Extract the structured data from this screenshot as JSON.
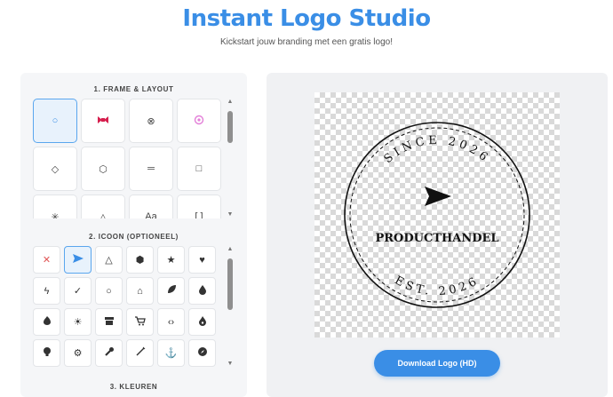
{
  "header": {
    "title": "Instant Logo Studio",
    "subtitle": "Kickstart jouw branding met een gratis logo!"
  },
  "sections": {
    "frame_title": "1. FRAME & LAYOUT",
    "icon_title": "2. ICOON (OPTIONEEL)",
    "colors_title": "3. KLEUREN"
  },
  "frames": [
    {
      "glyph": "○",
      "icon": "circle-frame-icon",
      "selected": true
    },
    {
      "glyph": "ribbon",
      "icon": "ribbon-frame-icon",
      "color": "#d61f4e"
    },
    {
      "glyph": "⊗",
      "icon": "cross-circle-frame-icon"
    },
    {
      "glyph": "flower",
      "icon": "flower-frame-icon",
      "color": "#e37fd8"
    },
    {
      "glyph": "◇",
      "icon": "diamond-frame-icon"
    },
    {
      "glyph": "⬡",
      "icon": "hexagon-frame-icon"
    },
    {
      "glyph": "═",
      "icon": "lines-frame-icon"
    },
    {
      "glyph": "□",
      "icon": "square-frame-icon"
    },
    {
      "glyph": "✳",
      "icon": "star-burst-frame-icon"
    },
    {
      "glyph": "△",
      "icon": "triangle-frame-icon"
    },
    {
      "glyph": "Aa",
      "icon": "text-frame-icon"
    },
    {
      "glyph": "[ ]",
      "icon": "brackets-frame-icon"
    }
  ],
  "icons": [
    {
      "glyph": "✕",
      "icon": "no-icon",
      "none": true
    },
    {
      "glyph": "send",
      "icon": "send-icon",
      "selected": true
    },
    {
      "glyph": "△",
      "icon": "warning-icon"
    },
    {
      "glyph": "⬢",
      "icon": "hexagon-icon"
    },
    {
      "glyph": "★",
      "icon": "star-icon"
    },
    {
      "glyph": "♥",
      "icon": "heart-icon"
    },
    {
      "glyph": "ϟ",
      "icon": "bolt-icon"
    },
    {
      "glyph": "✓",
      "icon": "check-icon"
    },
    {
      "glyph": "○",
      "icon": "circle-icon"
    },
    {
      "glyph": "⌂",
      "icon": "home-icon"
    },
    {
      "glyph": "leaf",
      "icon": "leaf-icon"
    },
    {
      "glyph": "drop",
      "icon": "drop-icon"
    },
    {
      "glyph": "flame",
      "icon": "flame-icon"
    },
    {
      "glyph": "☀",
      "icon": "sun-icon"
    },
    {
      "glyph": "store",
      "icon": "store-icon"
    },
    {
      "glyph": "cart",
      "icon": "cart-icon"
    },
    {
      "glyph": "‹›",
      "icon": "code-icon"
    },
    {
      "glyph": "fire",
      "icon": "fire-icon"
    },
    {
      "glyph": "bulb",
      "icon": "bulb-icon"
    },
    {
      "glyph": "⚙",
      "icon": "gear-icon"
    },
    {
      "glyph": "wrench",
      "icon": "wrench-icon"
    },
    {
      "glyph": "wand",
      "icon": "wand-icon"
    },
    {
      "glyph": "⚓",
      "icon": "anchor-icon"
    },
    {
      "glyph": "compass",
      "icon": "compass-icon"
    }
  ],
  "logo": {
    "top_text": "SINCE 2026",
    "main_text": "PRODUCTHANDEL",
    "bottom_text": "EST. 2026",
    "icon": "send-icon"
  },
  "download": {
    "label": "Download Logo (HD)"
  },
  "colors": {
    "accent": "#3a8ee6",
    "selected_bg": "#e8f2fc"
  }
}
